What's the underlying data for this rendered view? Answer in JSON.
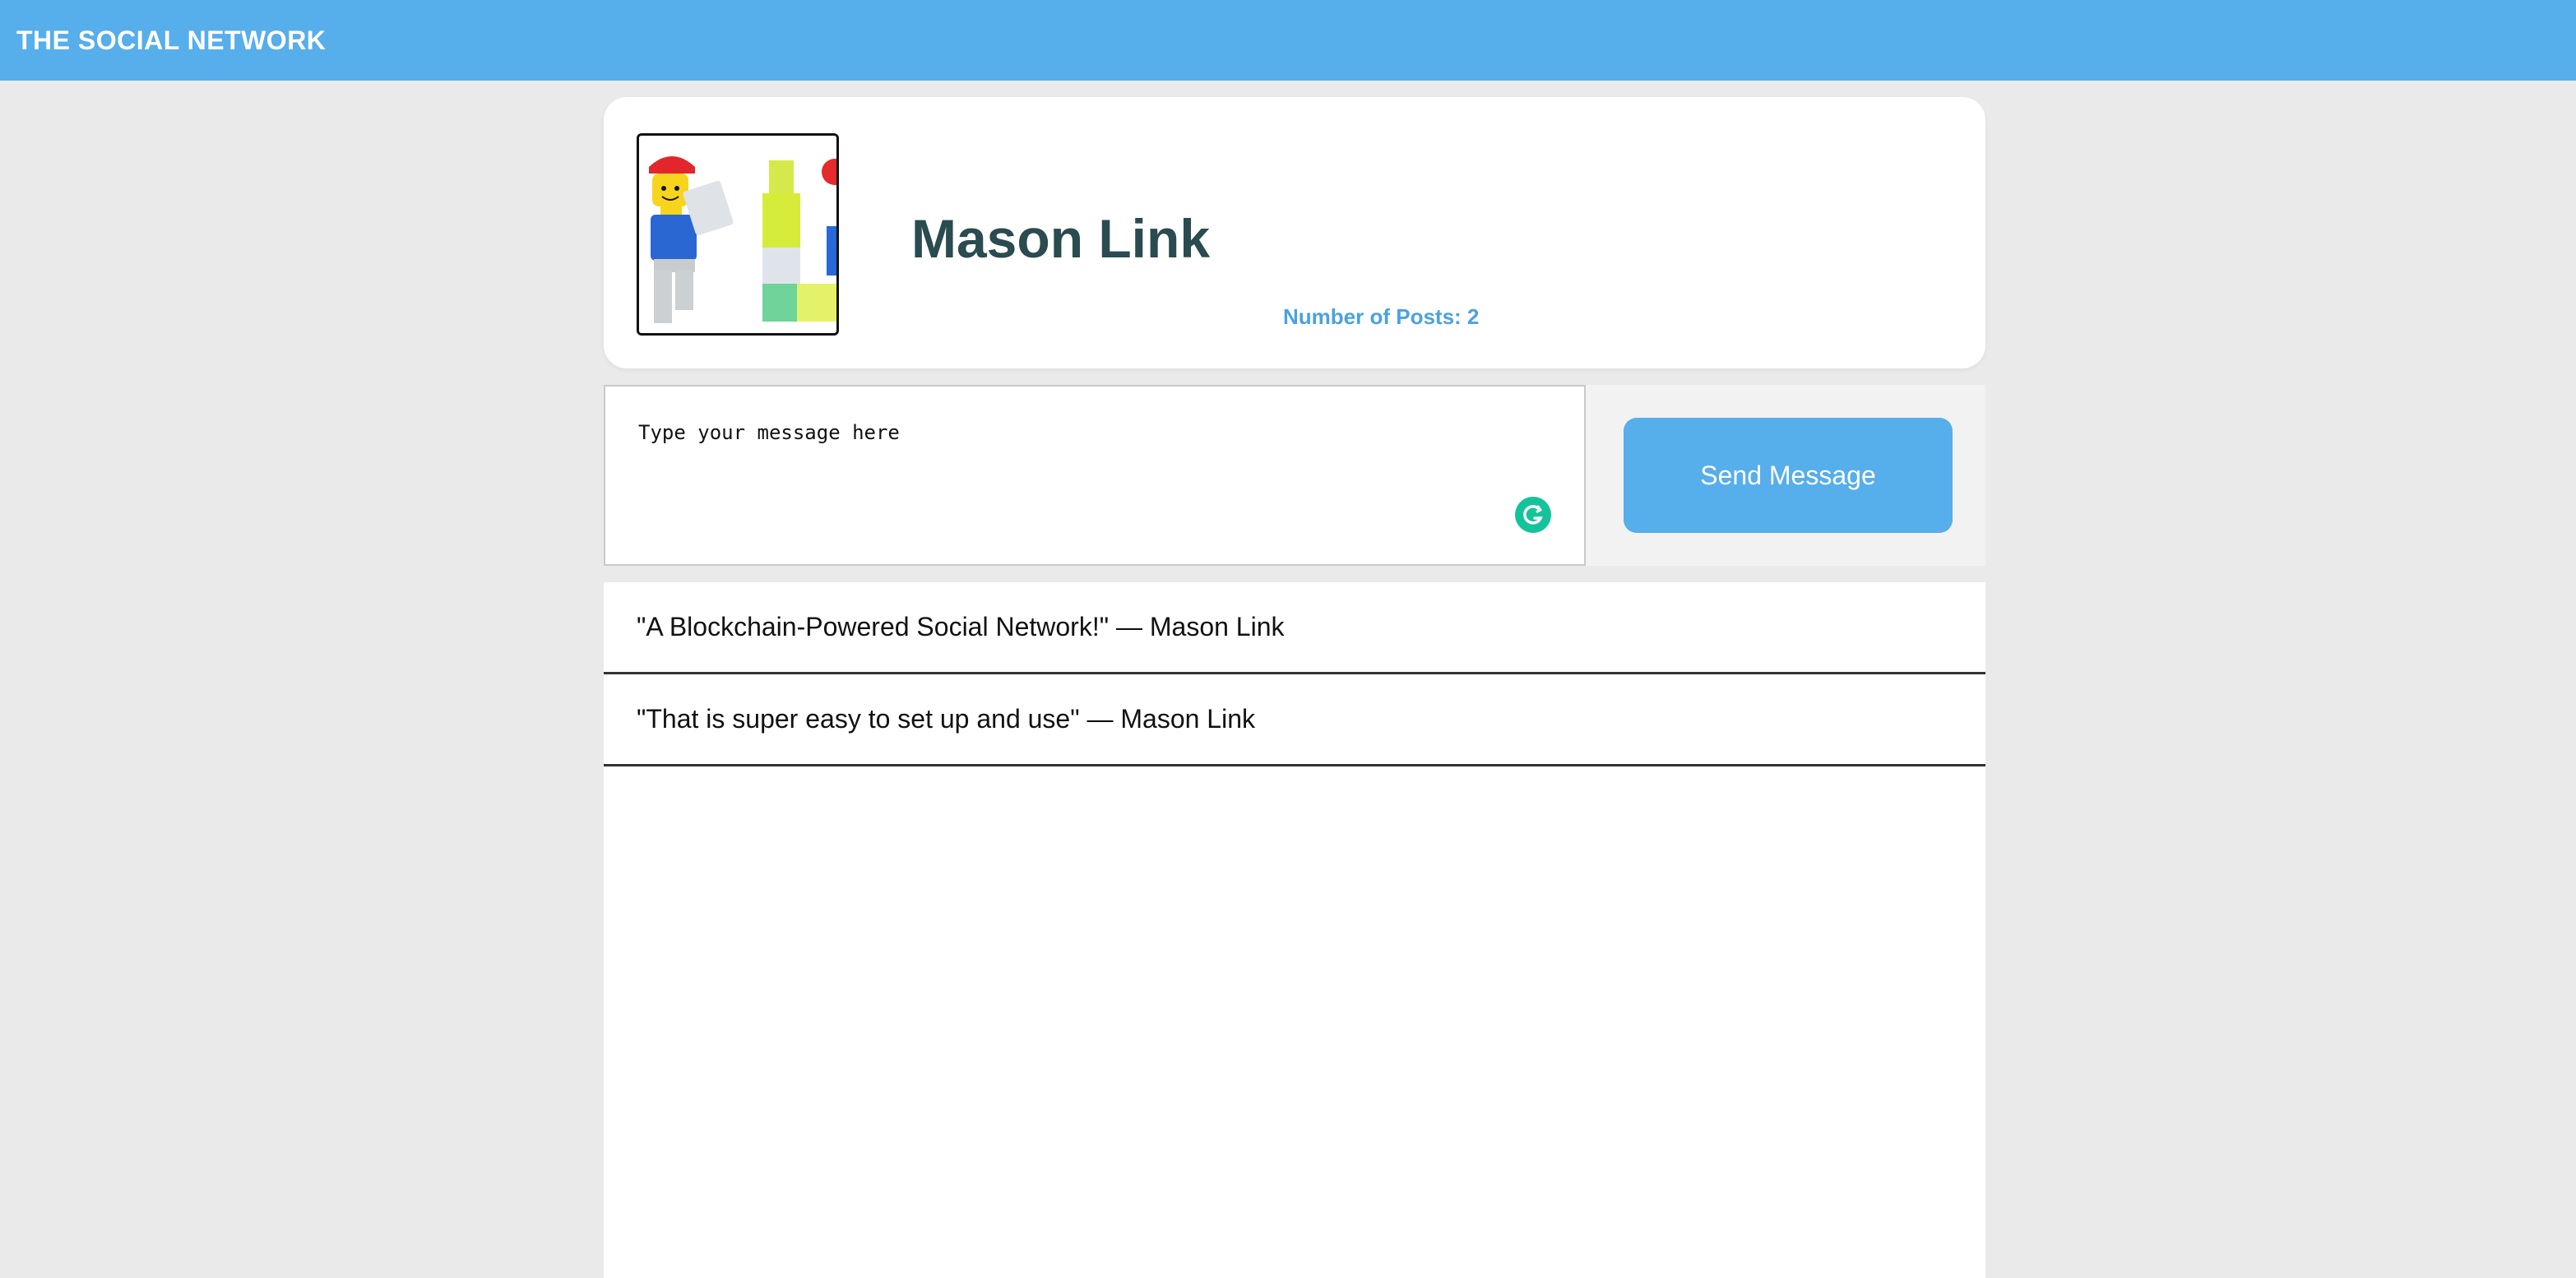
{
  "header": {
    "brand": "THE SOCIAL NETWORK"
  },
  "profile": {
    "name": "Mason Link",
    "post_count_label": "Number of Posts: 2",
    "avatar_icon": "lego-figures-avatar"
  },
  "composer": {
    "placeholder": "Type your message here",
    "value": "",
    "send_label": "Send Message",
    "assist_icon": "grammarly-g-icon"
  },
  "posts": [
    {
      "text": "\"A Blockchain-Powered Social Network!\" — Mason Link"
    },
    {
      "text": "\"That is super easy to set up and use\" — Mason Link"
    }
  ],
  "colors": {
    "accent": "#56aeea",
    "name": "#2a4b50",
    "post_count": "#4aa2e0",
    "assist_icon": "#15c39a"
  }
}
